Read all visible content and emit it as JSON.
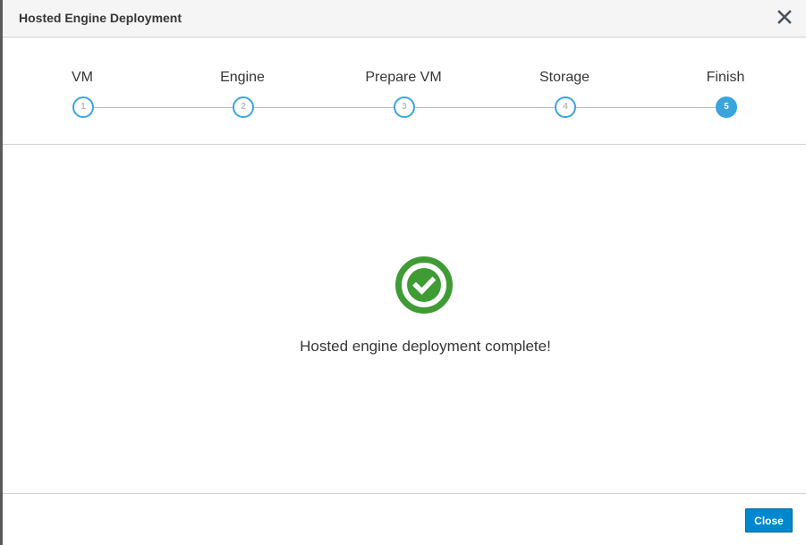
{
  "dialog": {
    "title": "Hosted Engine Deployment"
  },
  "wizard": {
    "steps": [
      {
        "label": "VM",
        "number": "1",
        "active": false
      },
      {
        "label": "Engine",
        "number": "2",
        "active": false
      },
      {
        "label": "Prepare VM",
        "number": "3",
        "active": false
      },
      {
        "label": "Storage",
        "number": "4",
        "active": false
      },
      {
        "label": "Finish",
        "number": "5",
        "active": true
      }
    ]
  },
  "result": {
    "message": "Hosted engine deployment complete!",
    "icon": "check-circle-icon",
    "icon_color": "#3f9c35"
  },
  "footer": {
    "close_label": "Close"
  },
  "colors": {
    "accent": "#39a5dc",
    "primary_button": "#0088ce",
    "success": "#3f9c35"
  }
}
